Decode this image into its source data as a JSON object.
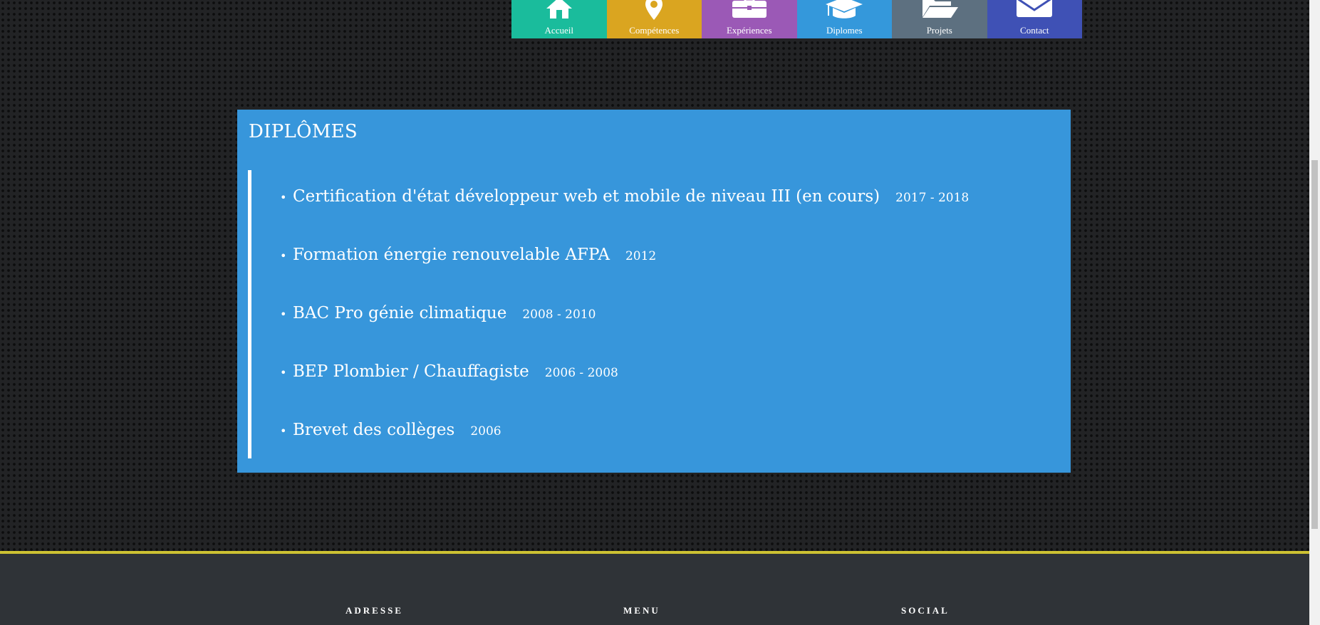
{
  "nav": {
    "items": [
      {
        "label": "Accueil",
        "icon": "home-icon",
        "color": "#1abc9c"
      },
      {
        "label": "Compétences",
        "icon": "map-marker-icon",
        "color": "#daa520"
      },
      {
        "label": "Expériences",
        "icon": "briefcase-icon",
        "color": "#9b59b6"
      },
      {
        "label": "Diplomes",
        "icon": "graduation-cap-icon",
        "color": "#3498db"
      },
      {
        "label": "Projets",
        "icon": "folder-open-icon",
        "color": "#5d7080"
      },
      {
        "label": "Contact",
        "icon": "envelope-icon",
        "color": "#3f51b5"
      }
    ]
  },
  "diplomas": {
    "title": "DIPLÔMES",
    "items": [
      {
        "title": "Certification d'état développeur web et mobile de niveau III (en cours)",
        "years": "2017 - 2018"
      },
      {
        "title": "Formation énergie renouvelable AFPA",
        "years": "2012"
      },
      {
        "title": "BAC Pro génie climatique",
        "years": "2008 - 2010"
      },
      {
        "title": "BEP Plombier / Chauffagiste",
        "years": "2006 - 2008"
      },
      {
        "title": "Brevet des collèges",
        "years": "2006"
      }
    ],
    "background_color": "#3796db"
  },
  "footer": {
    "headings": {
      "address": "ADRESSE",
      "menu": "MENU",
      "social": "SOCIAL"
    },
    "accent_color": "#cdc232",
    "background_color": "#2f3337"
  }
}
